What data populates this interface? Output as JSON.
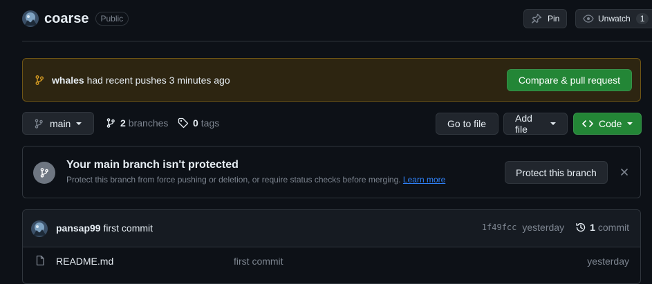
{
  "repo": {
    "name": "coarse",
    "visibility": "Public"
  },
  "header_actions": {
    "pin_label": "Pin",
    "unwatch_label": "Unwatch",
    "unwatch_count": "1"
  },
  "push_banner": {
    "branch": "whales",
    "message": "had recent pushes 3 minutes ago",
    "button_label": "Compare & pull request"
  },
  "toolbar": {
    "branch": "main",
    "branches_count": "2",
    "branches_label": "branches",
    "tags_count": "0",
    "tags_label": "tags",
    "go_to_file": "Go to file",
    "add_file": "Add file",
    "code": "Code"
  },
  "protect": {
    "title": "Your main branch isn't protected",
    "description": "Protect this branch from force pushing or deletion, or require status checks before merging.",
    "learn_more": "Learn more",
    "button_label": "Protect this branch"
  },
  "latest_commit": {
    "author": "pansap99",
    "message": "first commit",
    "sha": "1f49fcc",
    "time": "yesterday",
    "commit_count": "1",
    "commit_label": "commit"
  },
  "files": [
    {
      "name": "README.md",
      "message": "first commit",
      "time": "yesterday"
    }
  ],
  "colors": {
    "background": "#0d1117",
    "border": "#30363d",
    "primary_green": "#238636",
    "banner_bg": "#2d2511",
    "accent_blue": "#2f81f7",
    "muted_text": "#7d8590"
  }
}
